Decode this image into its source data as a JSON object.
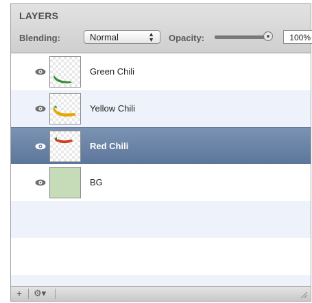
{
  "panel": {
    "title": "LAYERS",
    "blending_label": "Blending:",
    "blending_value": "Normal",
    "opacity_label": "Opacity:",
    "opacity_value": "100%",
    "opacity_level": 1.0
  },
  "layers": [
    {
      "name": "Green Chili",
      "thumb": "green-chili",
      "accent": "#2e8b2e",
      "selected": false
    },
    {
      "name": "Yellow Chili",
      "thumb": "yellow-chili",
      "accent": "#e8a600",
      "selected": false
    },
    {
      "name": "Red Chili",
      "thumb": "red-chili",
      "accent": "#d23c1e",
      "selected": true
    },
    {
      "name": "BG",
      "thumb": "solid",
      "accent": "#c6dcb8",
      "selected": false
    }
  ],
  "footer": {
    "add_icon": "+",
    "gear_icon": "⚙▾"
  },
  "colors": {
    "selection": "#6c84a8",
    "alt_row": "#edf2fb"
  }
}
